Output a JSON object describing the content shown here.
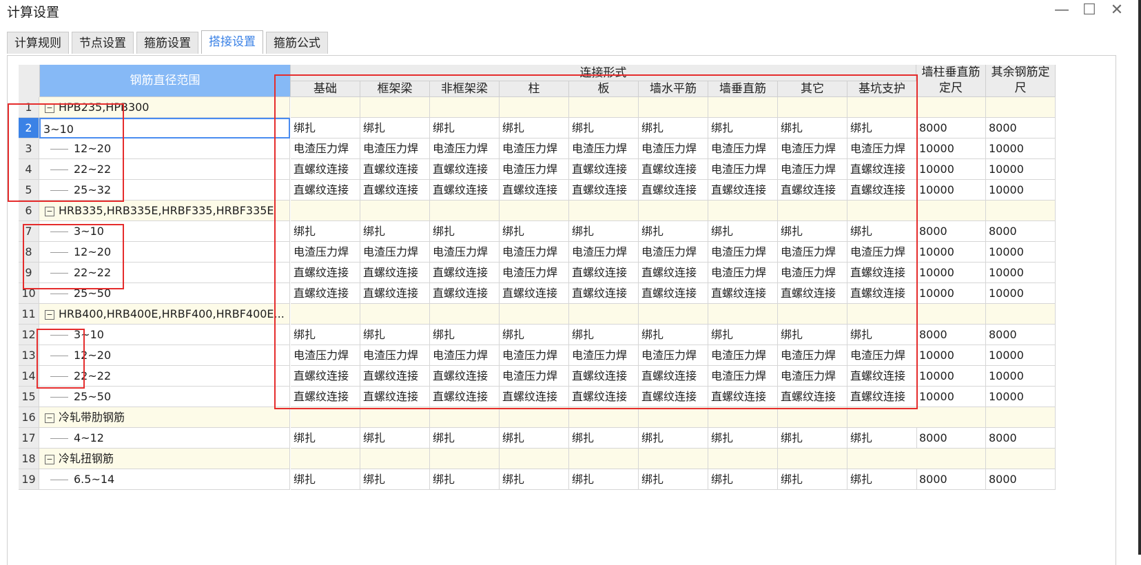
{
  "window": {
    "title": "计算设置",
    "minimize": "—",
    "maximize": "☐",
    "close": "✕"
  },
  "tabs": [
    "计算规则",
    "节点设置",
    "箍筋设置",
    "搭接设置",
    "箍筋公式"
  ],
  "active_tab": "搭接设置",
  "table": {
    "header_range": "钢筋直径范围",
    "header_group": "连接形式",
    "columns": [
      "基础",
      "框架梁",
      "非框架梁",
      "柱",
      "板",
      "墙水平筋",
      "墙垂直筋",
      "其它",
      "基坑支护"
    ],
    "header_wall": [
      "墙柱垂直筋",
      "定尺"
    ],
    "header_other": [
      "其余钢筋定",
      "尺"
    ],
    "rows": [
      {
        "num": "1",
        "type": "group",
        "label": "HPB235,HPB300",
        "expander": "−"
      },
      {
        "num": "2",
        "type": "item",
        "label": "3~10",
        "selected": true,
        "values": [
          "绑扎",
          "绑扎",
          "绑扎",
          "绑扎",
          "绑扎",
          "绑扎",
          "绑扎",
          "绑扎",
          "绑扎"
        ],
        "wall": "8000",
        "other": "8000"
      },
      {
        "num": "3",
        "type": "item",
        "label": "12~20",
        "values": [
          "电渣压力焊",
          "电渣压力焊",
          "电渣压力焊",
          "电渣压力焊",
          "电渣压力焊",
          "电渣压力焊",
          "电渣压力焊",
          "电渣压力焊",
          "电渣压力焊"
        ],
        "wall": "10000",
        "other": "10000"
      },
      {
        "num": "4",
        "type": "item",
        "label": "22~22",
        "values": [
          "直螺纹连接",
          "直螺纹连接",
          "直螺纹连接",
          "电渣压力焊",
          "直螺纹连接",
          "直螺纹连接",
          "电渣压力焊",
          "电渣压力焊",
          "直螺纹连接"
        ],
        "wall": "10000",
        "other": "10000"
      },
      {
        "num": "5",
        "type": "item",
        "label": "25~32",
        "values": [
          "直螺纹连接",
          "直螺纹连接",
          "直螺纹连接",
          "直螺纹连接",
          "直螺纹连接",
          "直螺纹连接",
          "直螺纹连接",
          "直螺纹连接",
          "直螺纹连接"
        ],
        "wall": "10000",
        "other": "10000"
      },
      {
        "num": "6",
        "type": "group",
        "label": "HRB335,HRB335E,HRBF335,HRBF335E",
        "expander": "−"
      },
      {
        "num": "7",
        "type": "item",
        "label": "3~10",
        "values": [
          "绑扎",
          "绑扎",
          "绑扎",
          "绑扎",
          "绑扎",
          "绑扎",
          "绑扎",
          "绑扎",
          "绑扎"
        ],
        "wall": "8000",
        "other": "8000"
      },
      {
        "num": "8",
        "type": "item",
        "label": "12~20",
        "values": [
          "电渣压力焊",
          "电渣压力焊",
          "电渣压力焊",
          "电渣压力焊",
          "电渣压力焊",
          "电渣压力焊",
          "电渣压力焊",
          "电渣压力焊",
          "电渣压力焊"
        ],
        "wall": "10000",
        "other": "10000"
      },
      {
        "num": "9",
        "type": "item",
        "label": "22~22",
        "values": [
          "直螺纹连接",
          "直螺纹连接",
          "直螺纹连接",
          "电渣压力焊",
          "直螺纹连接",
          "直螺纹连接",
          "电渣压力焊",
          "电渣压力焊",
          "直螺纹连接"
        ],
        "wall": "10000",
        "other": "10000"
      },
      {
        "num": "10",
        "type": "item",
        "label": "25~50",
        "values": [
          "直螺纹连接",
          "直螺纹连接",
          "直螺纹连接",
          "直螺纹连接",
          "直螺纹连接",
          "直螺纹连接",
          "直螺纹连接",
          "直螺纹连接",
          "直螺纹连接"
        ],
        "wall": "10000",
        "other": "10000"
      },
      {
        "num": "11",
        "type": "group",
        "label": "HRB400,HRB400E,HRBF400,HRBF400E...",
        "expander": "−"
      },
      {
        "num": "12",
        "type": "item",
        "label": "3~10",
        "values": [
          "绑扎",
          "绑扎",
          "绑扎",
          "绑扎",
          "绑扎",
          "绑扎",
          "绑扎",
          "绑扎",
          "绑扎"
        ],
        "wall": "8000",
        "other": "8000"
      },
      {
        "num": "13",
        "type": "item",
        "label": "12~20",
        "values": [
          "电渣压力焊",
          "电渣压力焊",
          "电渣压力焊",
          "电渣压力焊",
          "电渣压力焊",
          "电渣压力焊",
          "电渣压力焊",
          "电渣压力焊",
          "电渣压力焊"
        ],
        "wall": "10000",
        "other": "10000"
      },
      {
        "num": "14",
        "type": "item",
        "label": "22~22",
        "values": [
          "直螺纹连接",
          "直螺纹连接",
          "直螺纹连接",
          "电渣压力焊",
          "直螺纹连接",
          "直螺纹连接",
          "电渣压力焊",
          "电渣压力焊",
          "直螺纹连接"
        ],
        "wall": "10000",
        "other": "10000"
      },
      {
        "num": "15",
        "type": "item",
        "label": "25~50",
        "values": [
          "直螺纹连接",
          "直螺纹连接",
          "直螺纹连接",
          "直螺纹连接",
          "直螺纹连接",
          "直螺纹连接",
          "直螺纹连接",
          "直螺纹连接",
          "直螺纹连接"
        ],
        "wall": "10000",
        "other": "10000"
      },
      {
        "num": "16",
        "type": "group",
        "label": "冷轧带肋钢筋",
        "expander": "−"
      },
      {
        "num": "17",
        "type": "item",
        "label": "4~12",
        "values": [
          "绑扎",
          "绑扎",
          "绑扎",
          "绑扎",
          "绑扎",
          "绑扎",
          "绑扎",
          "绑扎",
          "绑扎"
        ],
        "wall": "8000",
        "other": "8000"
      },
      {
        "num": "18",
        "type": "group",
        "label": "冷轧扭钢筋",
        "expander": "−"
      },
      {
        "num": "19",
        "type": "item",
        "label": "6.5~14",
        "values": [
          "绑扎",
          "绑扎",
          "绑扎",
          "绑扎",
          "绑扎",
          "绑扎",
          "绑扎",
          "绑扎",
          "绑扎"
        ],
        "wall": "8000",
        "other": "8000"
      }
    ]
  },
  "colors": {
    "header_blue": "#86b9f6",
    "active_tab_text": "#3b82e6",
    "group_row_bg": "#fdfbe8",
    "annotation_red": "#e52c2c"
  }
}
